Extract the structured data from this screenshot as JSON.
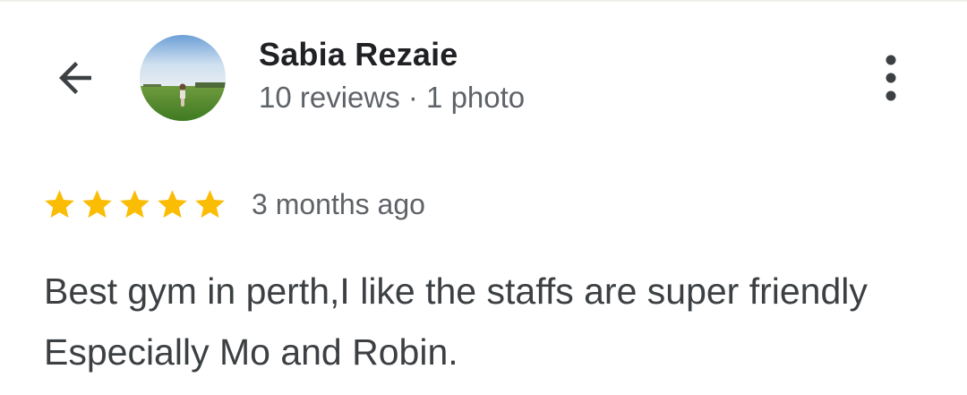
{
  "header": {
    "back_icon": "arrow-back-icon",
    "reviewer_name": "Sabia Rezaie",
    "reviewer_meta": "10 reviews · 1 photo",
    "more_icon": "more-vert-icon"
  },
  "review": {
    "rating": 5,
    "rating_max": 5,
    "star_color": "#fbbc04",
    "time": "3 months ago",
    "text": "Best gym in perth,I like the staffs are super friendly Especially Mo and Robin."
  }
}
